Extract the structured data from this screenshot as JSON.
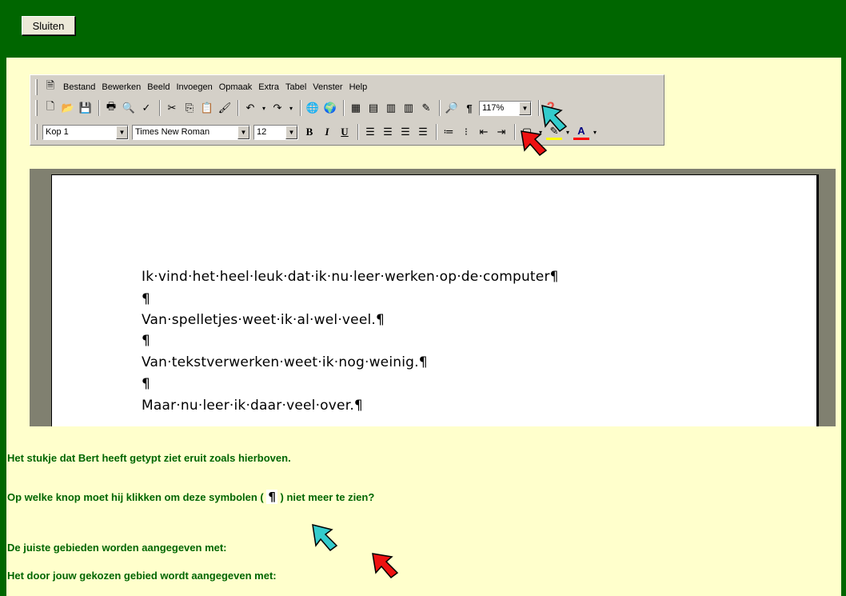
{
  "close_button": "Sluiten",
  "menubar": {
    "items": [
      "Bestand",
      "Bewerken",
      "Beeld",
      "Invoegen",
      "Opmaak",
      "Extra",
      "Tabel",
      "Venster",
      "Help"
    ]
  },
  "standard_toolbar": {
    "zoom": "117%"
  },
  "formatting_toolbar": {
    "style": "Kop 1",
    "font": "Times New Roman",
    "size": "12",
    "bold": "B",
    "italic": "I",
    "underline": "U",
    "font_color_label": "A"
  },
  "document": {
    "lines": [
      "Ik·vind·het·heel·leuk·dat·ik·nu·leer·werken·op·de·computer¶",
      "¶",
      "Van·spelletjes·weet·ik·al·wel·veel.¶",
      "¶",
      "Van·tekstverwerken·weet·ik·nog·weinig.¶",
      "¶",
      "Maar·nu·leer·ik·daar·veel·over.¶"
    ]
  },
  "questions": {
    "intro": "Het stukje dat Bert heeft getypt ziet eruit zoals hierboven.",
    "question_before": "Op welke knop moet hij klikken om deze symbolen (",
    "pilcrow": "¶",
    "question_after": ") niet meer te zien?",
    "correct_areas": "De juiste gebieden worden aangegeven met:",
    "chosen_area": "Het door jouw gekozen gebied wordt aangegeven met:"
  },
  "colors": {
    "green": "#006600",
    "cream": "#ffffcc",
    "cyan_arrow": "#33cccc",
    "red_arrow": "#ee1111"
  }
}
